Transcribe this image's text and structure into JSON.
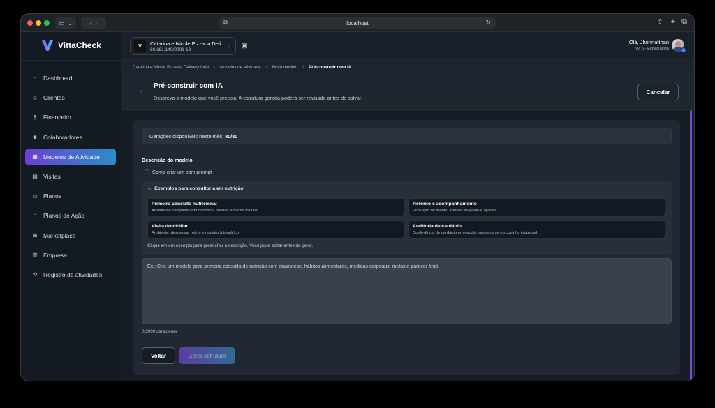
{
  "browser": {
    "url": "localhost"
  },
  "app": {
    "name": "VittaCheck"
  },
  "sidebar": {
    "items": [
      {
        "label": "Dashboard",
        "icon": "home-icon"
      },
      {
        "label": "Clientes",
        "icon": "users-icon"
      },
      {
        "label": "Financeiro",
        "icon": "dollar-icon"
      },
      {
        "label": "Colaboradores",
        "icon": "team-icon"
      },
      {
        "label": "Modelos de Atividade",
        "icon": "grid-icon",
        "active": true
      },
      {
        "label": "Visitas",
        "icon": "calendar-icon"
      },
      {
        "label": "Planos",
        "icon": "clipboard-icon"
      },
      {
        "label": "Planos de Ação",
        "icon": "document-icon"
      },
      {
        "label": "Marketplace",
        "icon": "cart-icon"
      },
      {
        "label": "Empresa",
        "icon": "building-icon"
      },
      {
        "label": "Registro de atividades",
        "icon": "history-icon"
      }
    ]
  },
  "topbar": {
    "company_name": "Catarina e Nicole Pizzaria Deli...",
    "company_cnpj": "86.161.140/0001-13",
    "company_logo_text": "V",
    "user_greeting": "Olá, Jhonnatthan",
    "user_level": "Nv. 5 - Especialista"
  },
  "breadcrumb": {
    "items": [
      "Catarina e Nicole Pizzaria Delivery Ltda",
      "Modelos de atividade",
      "Novo modelo",
      "Pré-construir com IA"
    ]
  },
  "header": {
    "title": "Pré-construir com IA",
    "subtitle": "Descreva o modelo que você precisa. A estrutura gerada poderá ser revisada antes de salvar.",
    "cancel_label": "Cancelar"
  },
  "form": {
    "generations_label": "Gerações disponíveis neste mês:",
    "generations_value": "80/80",
    "description_label": "Descrição do modelo",
    "prompt_help": "Como criar um bom prompt",
    "examples_title": "Exemplos para consultoria em nutrição",
    "examples": [
      {
        "title": "Primeira consulta nutricional",
        "desc": "Anamnese completa com histórico, hábitos e metas iniciais."
      },
      {
        "title": "Retorno e acompanhamento",
        "desc": "Evolução de metas, adesão ao plano e ajustes."
      },
      {
        "title": "Visita domiciliar",
        "desc": "Ambiente, despensa, rotina e registro fotográfico."
      },
      {
        "title": "Auditoria de cardápio",
        "desc": "Conferência de cardápio em escola, restaurante ou cozinha industrial."
      }
    ],
    "examples_hint": "Clique em um exemplo para preencher a descrição. Você pode editar antes de gerar.",
    "textarea_placeholder": "Ex.: Crie um modelo para primeira consulta de nutrição com anamnese, hábitos alimentares, medidas corporais, metas e parecer final.",
    "char_count": "0/3000 caracteres",
    "back_label": "Voltar",
    "generate_label": "Gerar estrutura"
  },
  "colors": {
    "accent_purple": "#6c3fd6",
    "accent_blue": "#2a8ec4"
  }
}
